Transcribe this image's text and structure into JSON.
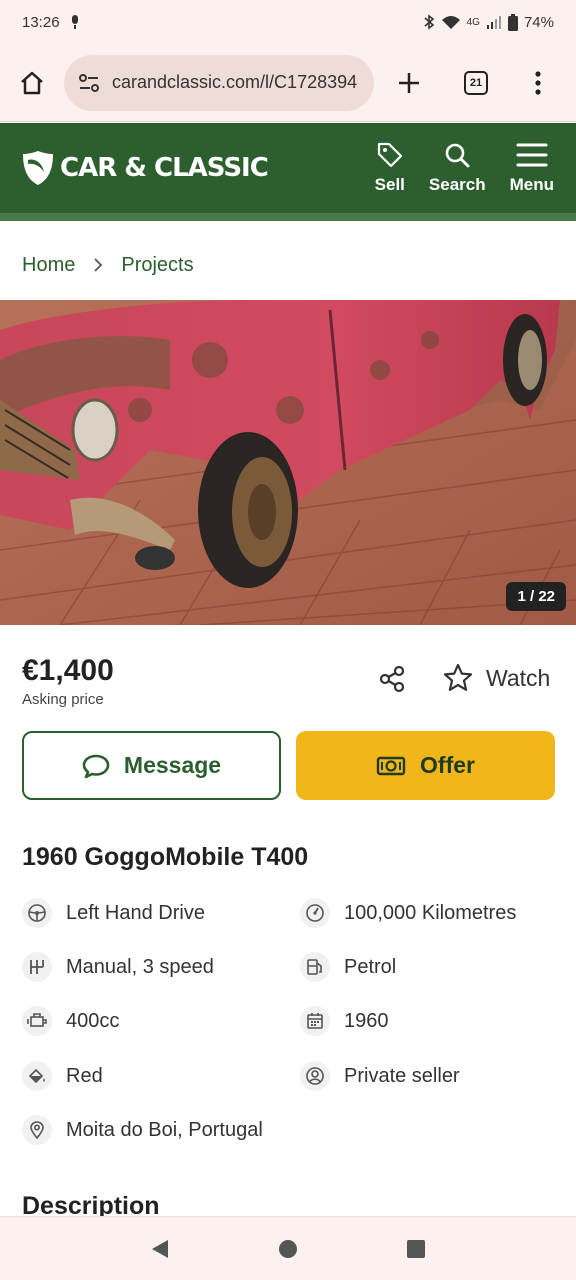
{
  "status_bar": {
    "time": "13:26",
    "network": "4G",
    "battery": "74%"
  },
  "browser": {
    "url": "carandclassic.com/l/C1728394",
    "tab_count": "21"
  },
  "site": {
    "logo_text": "CAR & CLASSIC",
    "nav": {
      "sell": "Sell",
      "search": "Search",
      "menu": "Menu"
    }
  },
  "breadcrumb": {
    "home": "Home",
    "projects": "Projects"
  },
  "gallery": {
    "counter": "1 / 22"
  },
  "listing": {
    "price": "€1,400",
    "price_label": "Asking price",
    "watch_label": "Watch",
    "message_label": "Message",
    "offer_label": "Offer",
    "title": "1960 GoggoMobile T400",
    "specs": {
      "drive": "Left Hand Drive",
      "mileage": "100,000 Kilometres",
      "transmission": "Manual, 3 speed",
      "fuel": "Petrol",
      "engine": "400cc",
      "year": "1960",
      "colour": "Red",
      "seller": "Private seller",
      "location": "Moita do Boi, Portugal"
    },
    "description_heading": "Description"
  },
  "colors": {
    "brand_green": "#2c5e2e",
    "offer_yellow": "#f0b61a"
  }
}
